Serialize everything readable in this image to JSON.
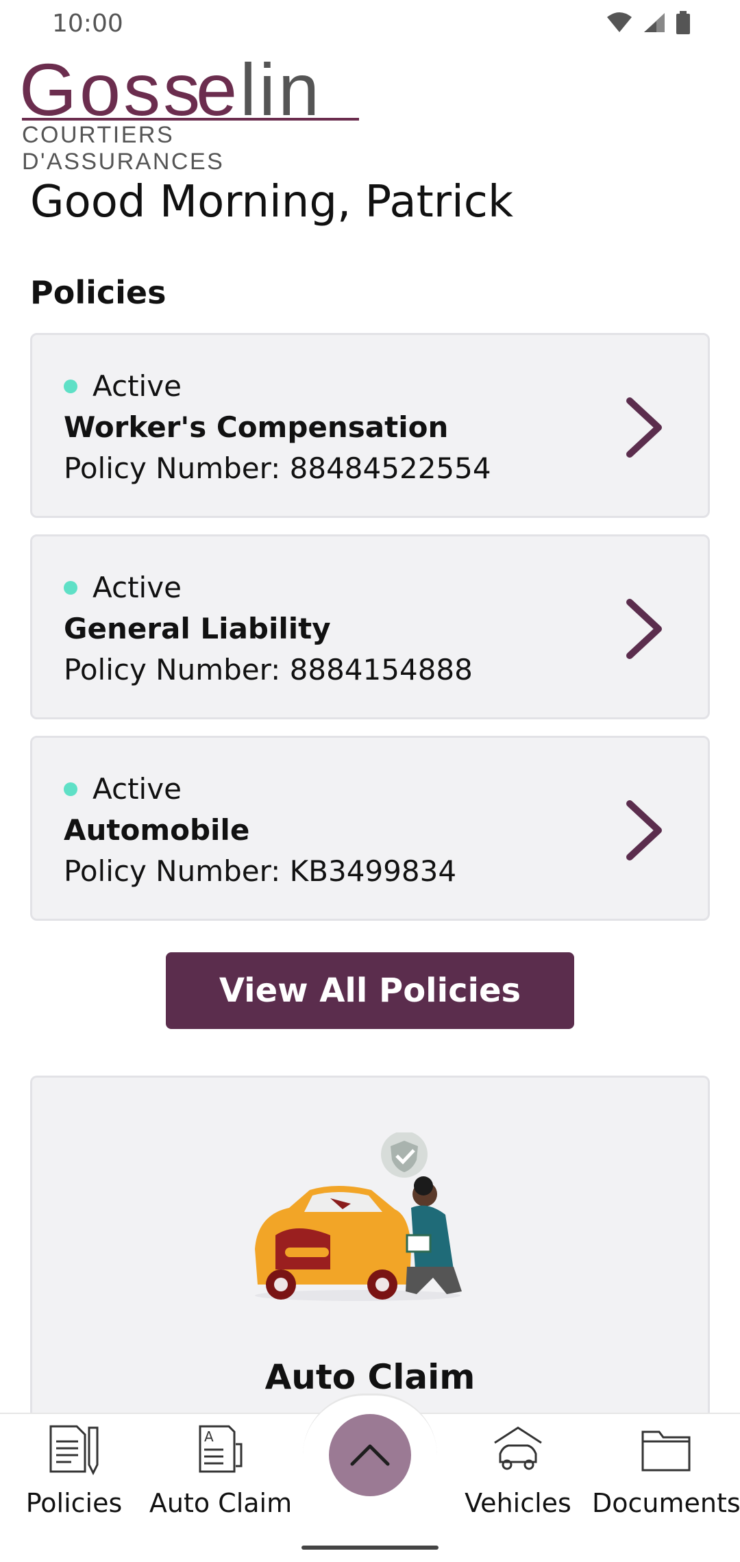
{
  "status_bar": {
    "time": "10:00"
  },
  "logo": {
    "word": "Gosselin",
    "subtitle": "COURTIERS D'ASSURANCES"
  },
  "greeting": "Good Morning, Patrick",
  "policies_section": {
    "title": "Policies",
    "items": [
      {
        "status": "Active",
        "name": "Worker's Compensation",
        "number": "Policy Number: 88484522554"
      },
      {
        "status": "Active",
        "name": "General Liability",
        "number": "Policy Number: 8884154888"
      },
      {
        "status": "Active",
        "name": "Automobile",
        "number": "Policy Number: KB3499834"
      }
    ],
    "view_all_label": "View All Policies"
  },
  "claim_card": {
    "title": "Auto Claim"
  },
  "bottom_nav": {
    "items": [
      {
        "label": "Policies",
        "icon": "policy-document-icon"
      },
      {
        "label": "Auto Claim",
        "icon": "claim-form-icon"
      },
      {
        "label": "Vehicles",
        "icon": "car-garage-icon"
      },
      {
        "label": "Documents",
        "icon": "folder-icon"
      }
    ],
    "fab_icon": "chevron-up-icon"
  },
  "colors": {
    "brand": "#5b2d4d",
    "active_dot": "#5fe0c6",
    "card_bg": "#f2f2f4",
    "fab": "#9b7a94"
  }
}
